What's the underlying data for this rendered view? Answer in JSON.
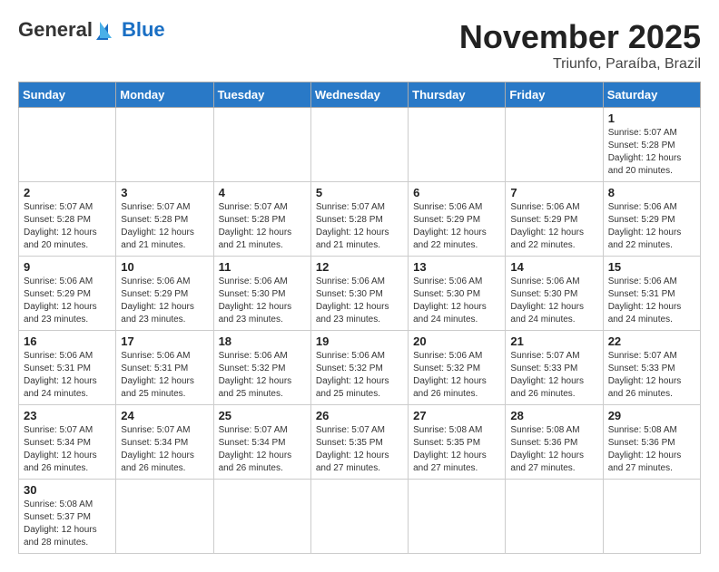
{
  "logo": {
    "general": "General",
    "blue": "Blue"
  },
  "title": "November 2025",
  "location": "Triunfo, Paraíba, Brazil",
  "weekdays": [
    "Sunday",
    "Monday",
    "Tuesday",
    "Wednesday",
    "Thursday",
    "Friday",
    "Saturday"
  ],
  "weeks": [
    [
      {
        "day": "",
        "info": ""
      },
      {
        "day": "",
        "info": ""
      },
      {
        "day": "",
        "info": ""
      },
      {
        "day": "",
        "info": ""
      },
      {
        "day": "",
        "info": ""
      },
      {
        "day": "",
        "info": ""
      },
      {
        "day": "1",
        "info": "Sunrise: 5:07 AM\nSunset: 5:28 PM\nDaylight: 12 hours and 20 minutes."
      }
    ],
    [
      {
        "day": "2",
        "info": "Sunrise: 5:07 AM\nSunset: 5:28 PM\nDaylight: 12 hours and 20 minutes."
      },
      {
        "day": "3",
        "info": "Sunrise: 5:07 AM\nSunset: 5:28 PM\nDaylight: 12 hours and 21 minutes."
      },
      {
        "day": "4",
        "info": "Sunrise: 5:07 AM\nSunset: 5:28 PM\nDaylight: 12 hours and 21 minutes."
      },
      {
        "day": "5",
        "info": "Sunrise: 5:07 AM\nSunset: 5:28 PM\nDaylight: 12 hours and 21 minutes."
      },
      {
        "day": "6",
        "info": "Sunrise: 5:06 AM\nSunset: 5:29 PM\nDaylight: 12 hours and 22 minutes."
      },
      {
        "day": "7",
        "info": "Sunrise: 5:06 AM\nSunset: 5:29 PM\nDaylight: 12 hours and 22 minutes."
      },
      {
        "day": "8",
        "info": "Sunrise: 5:06 AM\nSunset: 5:29 PM\nDaylight: 12 hours and 22 minutes."
      }
    ],
    [
      {
        "day": "9",
        "info": "Sunrise: 5:06 AM\nSunset: 5:29 PM\nDaylight: 12 hours and 23 minutes."
      },
      {
        "day": "10",
        "info": "Sunrise: 5:06 AM\nSunset: 5:29 PM\nDaylight: 12 hours and 23 minutes."
      },
      {
        "day": "11",
        "info": "Sunrise: 5:06 AM\nSunset: 5:30 PM\nDaylight: 12 hours and 23 minutes."
      },
      {
        "day": "12",
        "info": "Sunrise: 5:06 AM\nSunset: 5:30 PM\nDaylight: 12 hours and 23 minutes."
      },
      {
        "day": "13",
        "info": "Sunrise: 5:06 AM\nSunset: 5:30 PM\nDaylight: 12 hours and 24 minutes."
      },
      {
        "day": "14",
        "info": "Sunrise: 5:06 AM\nSunset: 5:30 PM\nDaylight: 12 hours and 24 minutes."
      },
      {
        "day": "15",
        "info": "Sunrise: 5:06 AM\nSunset: 5:31 PM\nDaylight: 12 hours and 24 minutes."
      }
    ],
    [
      {
        "day": "16",
        "info": "Sunrise: 5:06 AM\nSunset: 5:31 PM\nDaylight: 12 hours and 24 minutes."
      },
      {
        "day": "17",
        "info": "Sunrise: 5:06 AM\nSunset: 5:31 PM\nDaylight: 12 hours and 25 minutes."
      },
      {
        "day": "18",
        "info": "Sunrise: 5:06 AM\nSunset: 5:32 PM\nDaylight: 12 hours and 25 minutes."
      },
      {
        "day": "19",
        "info": "Sunrise: 5:06 AM\nSunset: 5:32 PM\nDaylight: 12 hours and 25 minutes."
      },
      {
        "day": "20",
        "info": "Sunrise: 5:06 AM\nSunset: 5:32 PM\nDaylight: 12 hours and 26 minutes."
      },
      {
        "day": "21",
        "info": "Sunrise: 5:07 AM\nSunset: 5:33 PM\nDaylight: 12 hours and 26 minutes."
      },
      {
        "day": "22",
        "info": "Sunrise: 5:07 AM\nSunset: 5:33 PM\nDaylight: 12 hours and 26 minutes."
      }
    ],
    [
      {
        "day": "23",
        "info": "Sunrise: 5:07 AM\nSunset: 5:34 PM\nDaylight: 12 hours and 26 minutes."
      },
      {
        "day": "24",
        "info": "Sunrise: 5:07 AM\nSunset: 5:34 PM\nDaylight: 12 hours and 26 minutes."
      },
      {
        "day": "25",
        "info": "Sunrise: 5:07 AM\nSunset: 5:34 PM\nDaylight: 12 hours and 26 minutes."
      },
      {
        "day": "26",
        "info": "Sunrise: 5:07 AM\nSunset: 5:35 PM\nDaylight: 12 hours and 27 minutes."
      },
      {
        "day": "27",
        "info": "Sunrise: 5:08 AM\nSunset: 5:35 PM\nDaylight: 12 hours and 27 minutes."
      },
      {
        "day": "28",
        "info": "Sunrise: 5:08 AM\nSunset: 5:36 PM\nDaylight: 12 hours and 27 minutes."
      },
      {
        "day": "29",
        "info": "Sunrise: 5:08 AM\nSunset: 5:36 PM\nDaylight: 12 hours and 27 minutes."
      }
    ],
    [
      {
        "day": "30",
        "info": "Sunrise: 5:08 AM\nSunset: 5:37 PM\nDaylight: 12 hours and 28 minutes."
      },
      {
        "day": "",
        "info": ""
      },
      {
        "day": "",
        "info": ""
      },
      {
        "day": "",
        "info": ""
      },
      {
        "day": "",
        "info": ""
      },
      {
        "day": "",
        "info": ""
      },
      {
        "day": "",
        "info": ""
      }
    ]
  ]
}
